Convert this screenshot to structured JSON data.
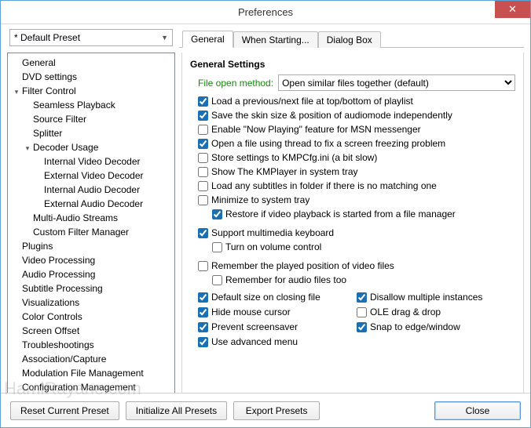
{
  "window": {
    "title": "Preferences",
    "close_glyph": "✕"
  },
  "preset": {
    "selected": "* Default Preset"
  },
  "tabs": {
    "items": [
      "General",
      "When Starting...",
      "Dialog Box"
    ],
    "active": 0
  },
  "tree": [
    {
      "label": "General",
      "expandable": true,
      "expanded": false
    },
    {
      "label": "DVD settings",
      "expandable": true,
      "expanded": false
    },
    {
      "label": "Filter Control",
      "expandable": true,
      "expanded": true,
      "children": [
        {
          "label": "Seamless Playback"
        },
        {
          "label": "Source Filter"
        },
        {
          "label": "Splitter"
        },
        {
          "label": "Decoder Usage",
          "expandable": true,
          "expanded": true,
          "children": [
            {
              "label": "Internal Video Decoder"
            },
            {
              "label": "External Video Decoder"
            },
            {
              "label": "Internal Audio Decoder"
            },
            {
              "label": "External Audio Decoder"
            }
          ]
        },
        {
          "label": "Multi-Audio Streams"
        },
        {
          "label": "Custom Filter Manager"
        }
      ]
    },
    {
      "label": "Plugins",
      "expandable": true,
      "expanded": false
    },
    {
      "label": "Video Processing",
      "expandable": true,
      "expanded": false
    },
    {
      "label": "Audio Processing",
      "expandable": true,
      "expanded": false
    },
    {
      "label": "Subtitle Processing",
      "expandable": true,
      "expanded": false
    },
    {
      "label": "Visualizations"
    },
    {
      "label": "Color Controls"
    },
    {
      "label": "Screen Offset"
    },
    {
      "label": "Troubleshootings"
    },
    {
      "label": "Association/Capture"
    },
    {
      "label": "Modulation File Management"
    },
    {
      "label": "Configuration Management"
    }
  ],
  "general": {
    "heading": "General Settings",
    "file_open_label": "File open method:",
    "file_open_value": "Open similar files together (default)",
    "checks": {
      "load_prev_next": {
        "label": "Load a previous/next file at top/bottom of playlist",
        "checked": true
      },
      "save_skin": {
        "label": "Save the skin size & position of audiomode independently",
        "checked": true
      },
      "now_playing": {
        "label": "Enable \"Now Playing\" feature for MSN messenger",
        "checked": false
      },
      "thread_open": {
        "label": "Open a file using thread to fix a screen freezing problem",
        "checked": true
      },
      "store_cfg": {
        "label": "Store settings to KMPCfg.ini (a bit slow)",
        "checked": false
      },
      "system_tray": {
        "label": "Show The KMPlayer in system tray",
        "checked": false
      },
      "load_subs": {
        "label": "Load any subtitles in folder if there is no matching one",
        "checked": false
      },
      "minimize_tray": {
        "label": "Minimize to system tray",
        "checked": false
      },
      "restore_fm": {
        "label": "Restore if video playback is started from a file manager",
        "checked": true
      },
      "mm_keyboard": {
        "label": "Support multimedia keyboard",
        "checked": true
      },
      "turn_on_volume": {
        "label": "Turn on volume control",
        "checked": false
      },
      "remember_pos": {
        "label": "Remember the played position of video files",
        "checked": false
      },
      "remember_audio": {
        "label": "Remember for audio files too",
        "checked": false
      },
      "default_size": {
        "label": "Default size on closing file",
        "checked": true
      },
      "hide_cursor": {
        "label": "Hide mouse cursor",
        "checked": true
      },
      "prevent_ss": {
        "label": "Prevent screensaver",
        "checked": true
      },
      "advanced_menu": {
        "label": "Use advanced menu",
        "checked": true
      },
      "disallow_multi": {
        "label": "Disallow multiple instances",
        "checked": true
      },
      "ole_drag": {
        "label": "OLE drag & drop",
        "checked": false
      },
      "snap_edge": {
        "label": "Snap to edge/window",
        "checked": true
      }
    }
  },
  "footer": {
    "reset": "Reset Current Preset",
    "init": "Initialize All Presets",
    "export": "Export Presets",
    "close": "Close"
  },
  "watermark": "HamiRayane.com"
}
